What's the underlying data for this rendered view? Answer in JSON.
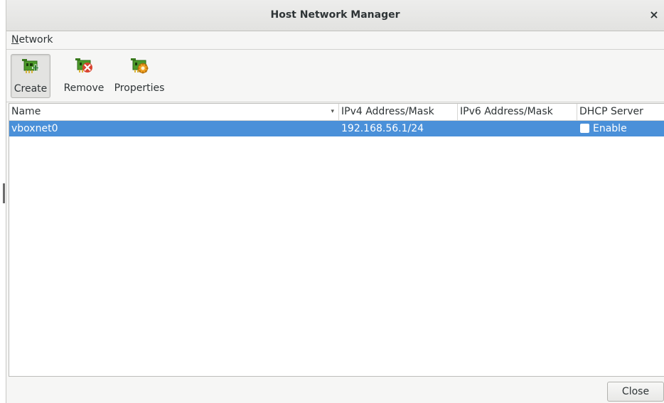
{
  "window": {
    "title": "Host Network Manager",
    "close_glyph": "×"
  },
  "menubar": {
    "items": [
      {
        "label": "Network",
        "mnemonic_first": "N",
        "rest": "etwork"
      }
    ]
  },
  "toolbar": {
    "buttons": [
      {
        "label": "Create",
        "icon": "network-card-add-icon",
        "pressed": true
      },
      {
        "label": "Remove",
        "icon": "network-card-remove-icon",
        "pressed": false
      },
      {
        "label": "Properties",
        "icon": "network-card-properties-icon",
        "pressed": false
      }
    ]
  },
  "table": {
    "columns": [
      "Name",
      "IPv4 Address/Mask",
      "IPv6 Address/Mask",
      "DHCP Server"
    ],
    "sort_indicator": "▾",
    "rows": [
      {
        "name": "vboxnet0",
        "ipv4": "192.168.56.1/24",
        "ipv6": "",
        "dhcp_checked": false,
        "dhcp_label": "Enable",
        "selected": true
      }
    ]
  },
  "footer": {
    "close_label": "Close"
  },
  "colors": {
    "selection": "#4a90d9",
    "card_green": "#4c9a2a",
    "remove_red": "#d9432f",
    "gear_orange": "#f0a020"
  }
}
